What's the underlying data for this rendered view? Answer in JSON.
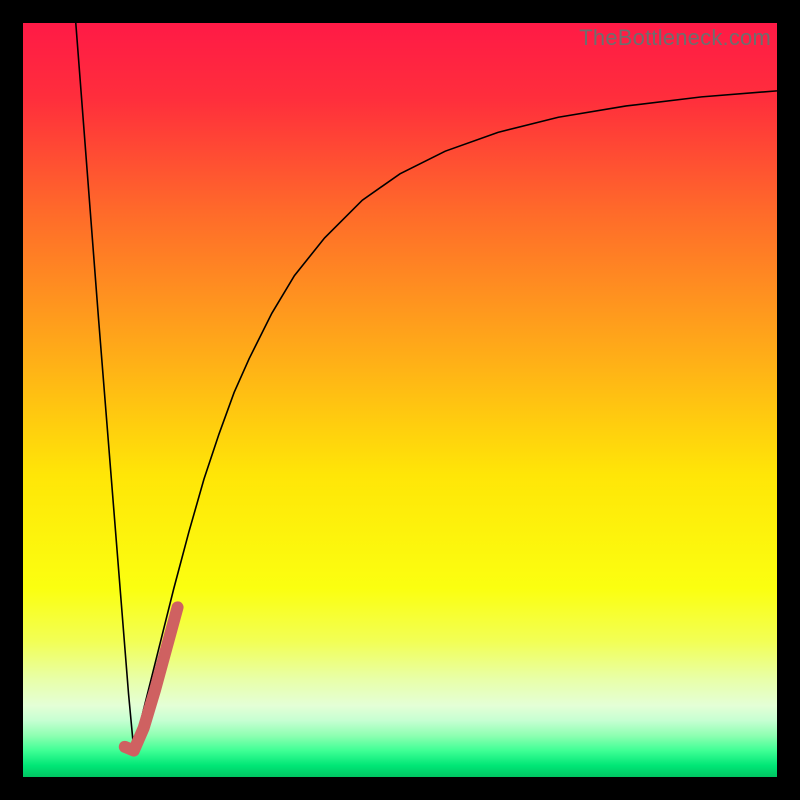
{
  "watermark": "TheBottleneck.com",
  "gradient": {
    "stops": [
      {
        "offset": 0.0,
        "color": "#ff1a46"
      },
      {
        "offset": 0.1,
        "color": "#ff2e3c"
      },
      {
        "offset": 0.25,
        "color": "#ff6a2a"
      },
      {
        "offset": 0.45,
        "color": "#ffb017"
      },
      {
        "offset": 0.6,
        "color": "#ffe607"
      },
      {
        "offset": 0.75,
        "color": "#fbff10"
      },
      {
        "offset": 0.82,
        "color": "#f2ff55"
      },
      {
        "offset": 0.87,
        "color": "#e8ffa8"
      },
      {
        "offset": 0.905,
        "color": "#e4ffd6"
      },
      {
        "offset": 0.925,
        "color": "#c6ffd2"
      },
      {
        "offset": 0.945,
        "color": "#8effb2"
      },
      {
        "offset": 0.965,
        "color": "#3fff95"
      },
      {
        "offset": 0.985,
        "color": "#00e676"
      },
      {
        "offset": 1.0,
        "color": "#00c562"
      }
    ]
  },
  "chart_data": {
    "type": "line",
    "title": "",
    "xlabel": "",
    "ylabel": "",
    "xlim": [
      0,
      100
    ],
    "ylim": [
      0,
      100
    ],
    "series": [
      {
        "name": "black-curve-left",
        "stroke": "#000000",
        "width": 1.6,
        "x": [
          7.0,
          8.0,
          9.0,
          10.0,
          11.0,
          12.0,
          13.0,
          14.0,
          14.7
        ],
        "values": [
          100.0,
          87.0,
          74.0,
          61.0,
          48.5,
          36.0,
          23.5,
          11.0,
          3.5
        ]
      },
      {
        "name": "black-curve-right",
        "stroke": "#000000",
        "width": 1.6,
        "x": [
          14.7,
          16,
          18,
          20,
          22,
          24,
          26,
          28,
          30,
          33,
          36,
          40,
          45,
          50,
          56,
          63,
          71,
          80,
          90,
          100
        ],
        "values": [
          3.5,
          9,
          17,
          25,
          32.5,
          39.5,
          45.5,
          51,
          55.5,
          61.5,
          66.5,
          71.5,
          76.5,
          80,
          83,
          85.5,
          87.5,
          89,
          90.2,
          91
        ]
      },
      {
        "name": "pink-marker",
        "stroke": "#cf6161",
        "width": 12,
        "linecap": "round",
        "x": [
          13.5,
          14.7,
          16.0,
          17.5,
          19.0,
          20.5
        ],
        "values": [
          4.0,
          3.5,
          6.5,
          11.5,
          17.0,
          22.5
        ]
      }
    ]
  }
}
